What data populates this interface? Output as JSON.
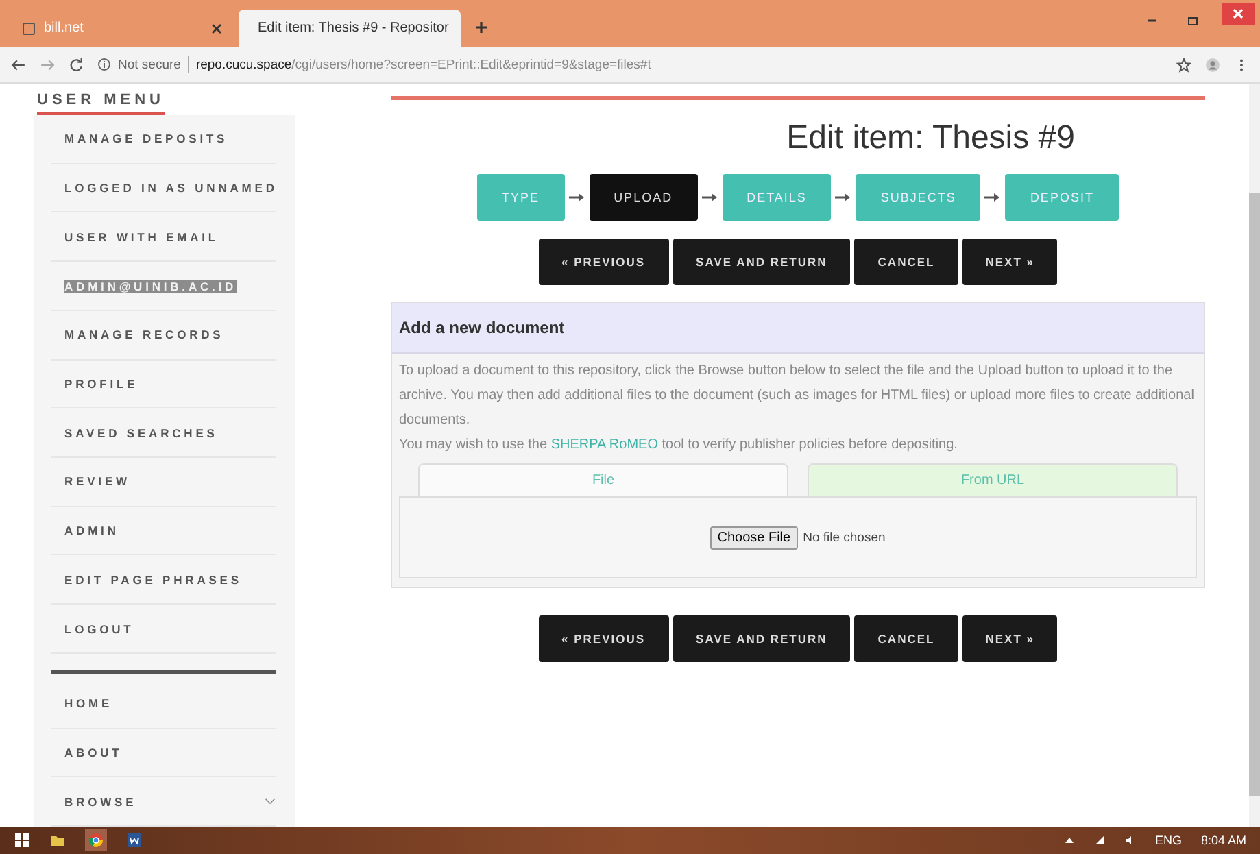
{
  "browser": {
    "tabs": [
      {
        "title": "bill.net",
        "selected": false
      },
      {
        "title": "Edit item: Thesis #9 - Repositor",
        "selected": true
      }
    ],
    "security": "Not secure",
    "url_host": "repo.cucu.space",
    "url_path": "/cgi/users/home?screen=EPrint::Edit&eprintid=9&stage=files#t"
  },
  "sidebar": {
    "title": "USER MENU",
    "items": [
      {
        "label": "MANAGE DEPOSITS",
        "highlighted": false
      },
      {
        "label": "LOGGED IN AS UNNAMED",
        "highlighted": false
      },
      {
        "label": "USER WITH EMAIL",
        "highlighted": false
      },
      {
        "label": "ADMIN@UINIB.AC.ID",
        "highlighted": true
      },
      {
        "label": "MANAGE RECORDS",
        "highlighted": false
      },
      {
        "label": "PROFILE",
        "highlighted": false
      },
      {
        "label": "SAVED SEARCHES",
        "highlighted": false
      },
      {
        "label": "REVIEW",
        "highlighted": false
      },
      {
        "label": "ADMIN",
        "highlighted": false
      },
      {
        "label": "EDIT PAGE PHRASES",
        "highlighted": false
      },
      {
        "label": "LOGOUT",
        "highlighted": false
      }
    ],
    "nav": [
      {
        "label": "HOME",
        "expandable": false
      },
      {
        "label": "ABOUT",
        "expandable": false
      },
      {
        "label": "BROWSE",
        "expandable": true
      }
    ]
  },
  "page_title": "Edit item: Thesis #9",
  "steps": [
    {
      "label": "TYPE",
      "selected": false
    },
    {
      "label": "UPLOAD",
      "selected": true
    },
    {
      "label": "DETAILS",
      "selected": false
    },
    {
      "label": "SUBJECTS",
      "selected": false
    },
    {
      "label": "DEPOSIT",
      "selected": false
    }
  ],
  "actions_top": [
    "« PREVIOUS",
    "SAVE AND RETURN",
    "CANCEL",
    "NEXT »"
  ],
  "panel": {
    "title": "Add a new document",
    "text": "To upload a document to this repository, click the Browse button below to select the file and the Upload button to upload it to the archive. You may then add additional files to the document (such as images for HTML files) or upload more files to create additional documents.",
    "text2_before": "You may wish to use the",
    "link": "SHERPA RoMEO",
    "text2_after": "tool to verify publisher policies before depositing.",
    "tabs": [
      {
        "label": "File",
        "selected": true
      },
      {
        "label": "From URL",
        "selected": false
      }
    ],
    "choose_button": "Choose File",
    "file_status": "No file chosen"
  },
  "actions_bottom": [
    "« PREVIOUS",
    "SAVE AND RETURN",
    "CANCEL",
    "NEXT »"
  ],
  "taskbar": {
    "language": "ENG",
    "time": "8:04 AM"
  }
}
